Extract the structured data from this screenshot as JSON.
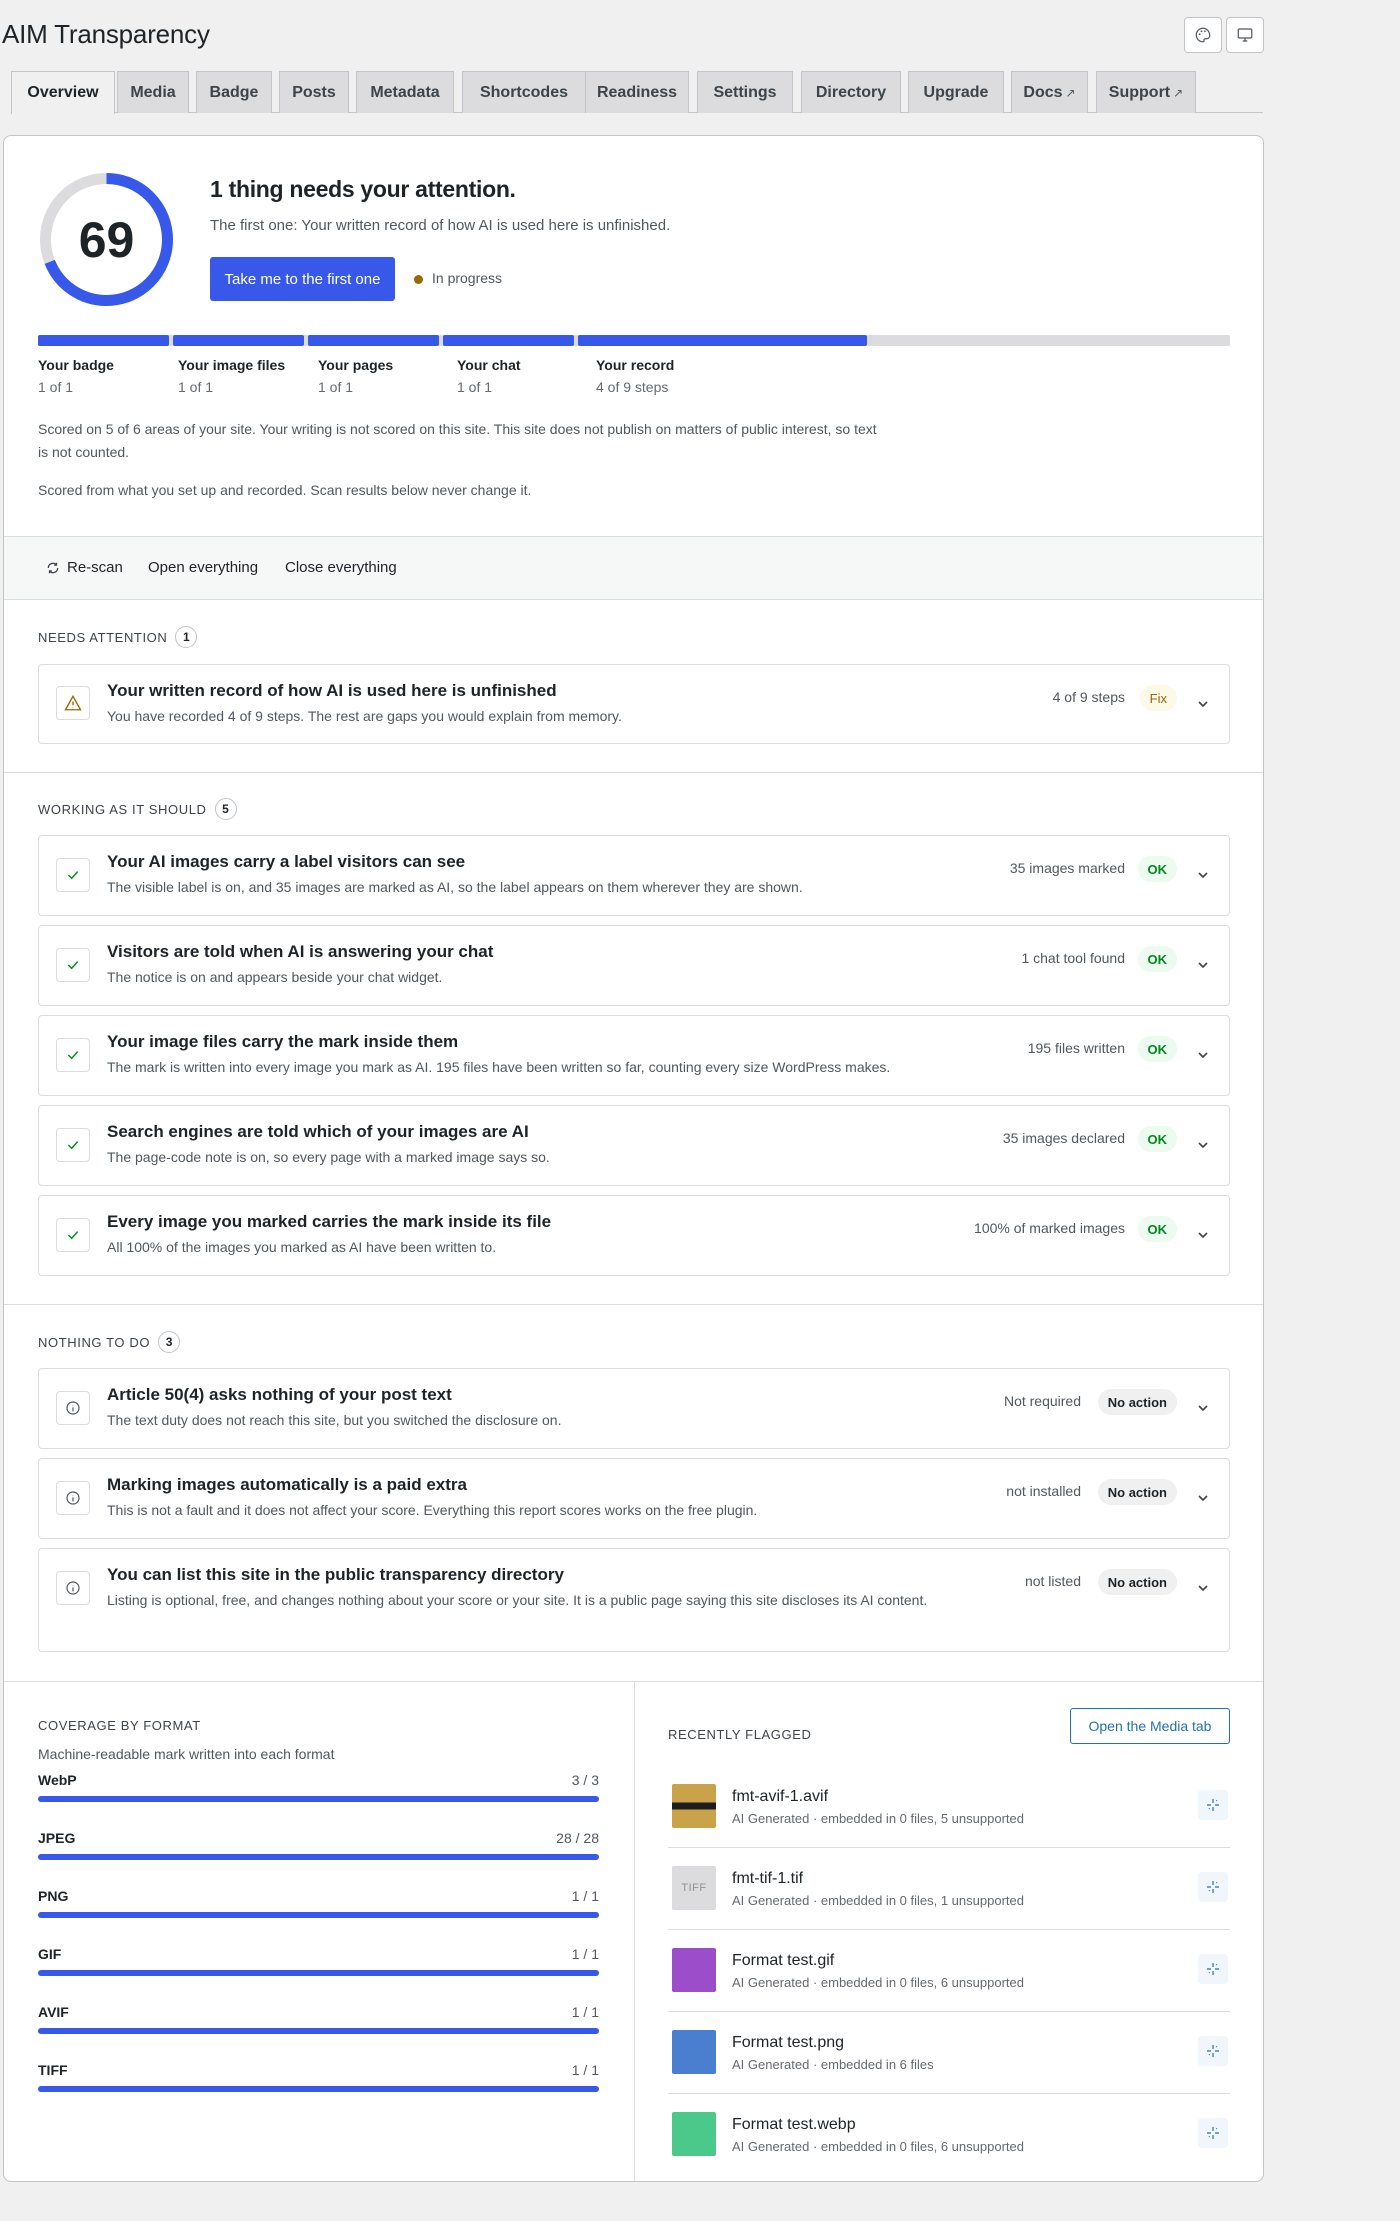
{
  "app": {
    "title": "AIM Transparency"
  },
  "header_icons": {
    "theme": "palette-icon",
    "preview": "monitor-icon"
  },
  "tabs": [
    {
      "label": "Overview",
      "active": true
    },
    {
      "label": "Media"
    },
    {
      "label": "Badge"
    },
    {
      "label": "Posts"
    },
    {
      "label": "Metadata"
    },
    {
      "label": "Shortcodes"
    },
    {
      "label": "Readiness"
    },
    {
      "label": "Settings"
    },
    {
      "label": "Directory"
    },
    {
      "label": "Upgrade"
    },
    {
      "label": "Docs",
      "external": "↗"
    },
    {
      "label": "Support",
      "external": "↗"
    }
  ],
  "summary": {
    "score": "69",
    "score_percent": 69,
    "title": "1 thing needs your attention.",
    "subtitle": "The first one: Your written record of how AI is used here is unfinished.",
    "primary_button": "Take me to the first one",
    "status": "In progress",
    "status_color": "#996800",
    "accent_color": "#3858e9",
    "areas": [
      {
        "label": "Your badge",
        "value": "1 of 1",
        "fraction": 1
      },
      {
        "label": "Your image files",
        "value": "1 of 1",
        "fraction": 1
      },
      {
        "label": "Your pages",
        "value": "1 of 1",
        "fraction": 1
      },
      {
        "label": "Your chat",
        "value": "1 of 1",
        "fraction": 1
      },
      {
        "label": "Your record",
        "value": "4 of 9 steps",
        "fraction": 0.444
      }
    ],
    "note1": "Scored on 5 of 6 areas of your site. Your writing is not scored on this site. This site does not publish on matters of public interest, so text is not counted.",
    "note2": "Scored from what you set up and recorded. Scan results below never change it."
  },
  "toolbar": {
    "rescan": "Re-scan",
    "open_all": "Open everything",
    "close_all": "Close everything"
  },
  "needs_attention": {
    "heading": "Needs attention",
    "count": "1",
    "items": [
      {
        "title": "Your written record of how AI is used here is unfinished",
        "desc": "You have recorded 4 of 9 steps. The rest are gaps you would explain from memory.",
        "meta": "4 of 9 steps",
        "badge": "Fix",
        "icon": "warning-icon"
      }
    ]
  },
  "working": {
    "heading": "Working as it should",
    "count": "5",
    "items": [
      {
        "title": "Your AI images carry a label visitors can see",
        "desc": "The visible label is on, and 35 images are marked as AI, so the label appears on them wherever they are shown.",
        "meta": "35 images marked",
        "badge": "OK",
        "icon": "check-icon"
      },
      {
        "title": "Visitors are told when AI is answering your chat",
        "desc": "The notice is on and appears beside your chat widget.",
        "meta": "1 chat tool found",
        "badge": "OK",
        "icon": "check-icon"
      },
      {
        "title": "Your image files carry the mark inside them",
        "desc": "The mark is written into every image you mark as AI. 195 files have been written so far, counting every size WordPress makes.",
        "meta": "195 files written",
        "badge": "OK",
        "icon": "check-icon"
      },
      {
        "title": "Search engines are told which of your images are AI",
        "desc": "The page-code note is on, so every page with a marked image says so.",
        "meta": "35 images declared",
        "badge": "OK",
        "icon": "check-icon"
      },
      {
        "title": "Every image you marked carries the mark inside its file",
        "desc": "All 100% of the images you marked as AI have been written to.",
        "meta": "100% of marked images",
        "badge": "OK",
        "icon": "check-icon"
      }
    ]
  },
  "nothing": {
    "heading": "Nothing to do",
    "count": "3",
    "items": [
      {
        "title": "Article 50(4) asks nothing of your post text",
        "desc": "The text duty does not reach this site, but you switched the disclosure on.",
        "meta": "Not required",
        "badge": "No action",
        "icon": "info-icon"
      },
      {
        "title": "Marking images automatically is a paid extra",
        "desc": "This is not a fault and it does not affect your score. Everything this report scores works on the free plugin.",
        "meta": "not installed",
        "badge": "No action",
        "icon": "info-icon"
      },
      {
        "title": "You can list this site in the public transparency directory",
        "desc": "Listing is optional, free, and changes nothing about your score or your site. It is a public page saying this site discloses its AI content.",
        "meta": "not listed",
        "badge": "No action",
        "icon": "info-icon"
      }
    ]
  },
  "coverage": {
    "heading": "Coverage by format",
    "subtitle": "Machine-readable mark written into each format",
    "formats": [
      {
        "name": "WebP",
        "count": "3 / 3",
        "fraction": 1
      },
      {
        "name": "JPEG",
        "count": "28 / 28",
        "fraction": 1
      },
      {
        "name": "PNG",
        "count": "1 / 1",
        "fraction": 1
      },
      {
        "name": "GIF",
        "count": "1 / 1",
        "fraction": 1
      },
      {
        "name": "AVIF",
        "count": "1 / 1",
        "fraction": 1
      },
      {
        "name": "TIFF",
        "count": "1 / 1",
        "fraction": 1
      }
    ]
  },
  "recent": {
    "heading": "Recently flagged",
    "button": "Open the Media tab",
    "items": [
      {
        "name": "fmt-avif-1.avif",
        "meta": "AI Generated · embedded in 0 files, 5 unsupported",
        "thumb_color": "#c9a24a",
        "thumb_kind": "avif-thumbnail"
      },
      {
        "name": "fmt-tif-1.tif",
        "meta": "AI Generated · embedded in 0 files, 1 unsupported",
        "thumb_color": "#dcdcde",
        "thumb_text": "TIFF"
      },
      {
        "name": "Format test.gif",
        "meta": "AI Generated · embedded in 0 files, 6 unsupported",
        "thumb_color": "#9b4dca"
      },
      {
        "name": "Format test.png",
        "meta": "AI Generated · embedded in 6 files",
        "thumb_color": "#4a7fcf"
      },
      {
        "name": "Format test.webp",
        "meta": "AI Generated · embedded in 0 files, 6 unsupported",
        "thumb_color": "#4ac98a"
      }
    ]
  }
}
